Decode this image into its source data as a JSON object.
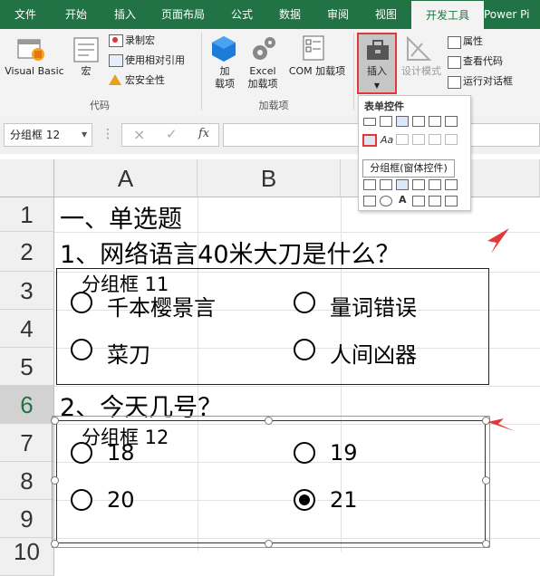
{
  "tabs": [
    "文件",
    "开始",
    "插入",
    "页面布局",
    "公式",
    "数据",
    "审阅",
    "视图",
    "开发工具",
    "Power Pi"
  ],
  "active_tab": "开发工具",
  "ribbon": {
    "code_group": {
      "label": "代码",
      "visual_basic": "Visual Basic",
      "macro": "宏",
      "record_macro": "录制宏",
      "relative_ref": "使用相对引用",
      "macro_security": "宏安全性"
    },
    "addins_group": {
      "label": "加载项",
      "addins": "加\n载项",
      "excel_addins": "Excel\n加载项",
      "com_addins": "COM 加载项"
    },
    "controls_group": {
      "insert": "插入",
      "design_mode": "设计模式",
      "properties": "属性",
      "view_code": "查看代码",
      "run_dialog": "运行对话框"
    }
  },
  "controls_panel": {
    "title": "表单控件",
    "tooltip": "分组框(窗体控件)"
  },
  "name_box": "分组框 12",
  "formula_icons": {
    "cancel": "×",
    "enter": "✓",
    "fx": "fx"
  },
  "columns": [
    "A",
    "B"
  ],
  "rows": [
    "1",
    "2",
    "3",
    "4",
    "5",
    "6",
    "7",
    "8",
    "9",
    "10"
  ],
  "selected_row": "6",
  "cells": {
    "a1": "一、单选题",
    "a2": "1、网络语言40米大刀是什么？",
    "a6": "2、今天几号？"
  },
  "group1": {
    "title": "分组框 11",
    "options": [
      "千本樱景言",
      "量词错误",
      "菜刀",
      "人间凶器"
    ],
    "selected": null
  },
  "group2": {
    "title": "分组框 12",
    "options": [
      "18",
      "19",
      "20",
      "21"
    ],
    "selected": "21"
  },
  "colors": {
    "accent": "#217346",
    "highlight": "#e0393b"
  }
}
